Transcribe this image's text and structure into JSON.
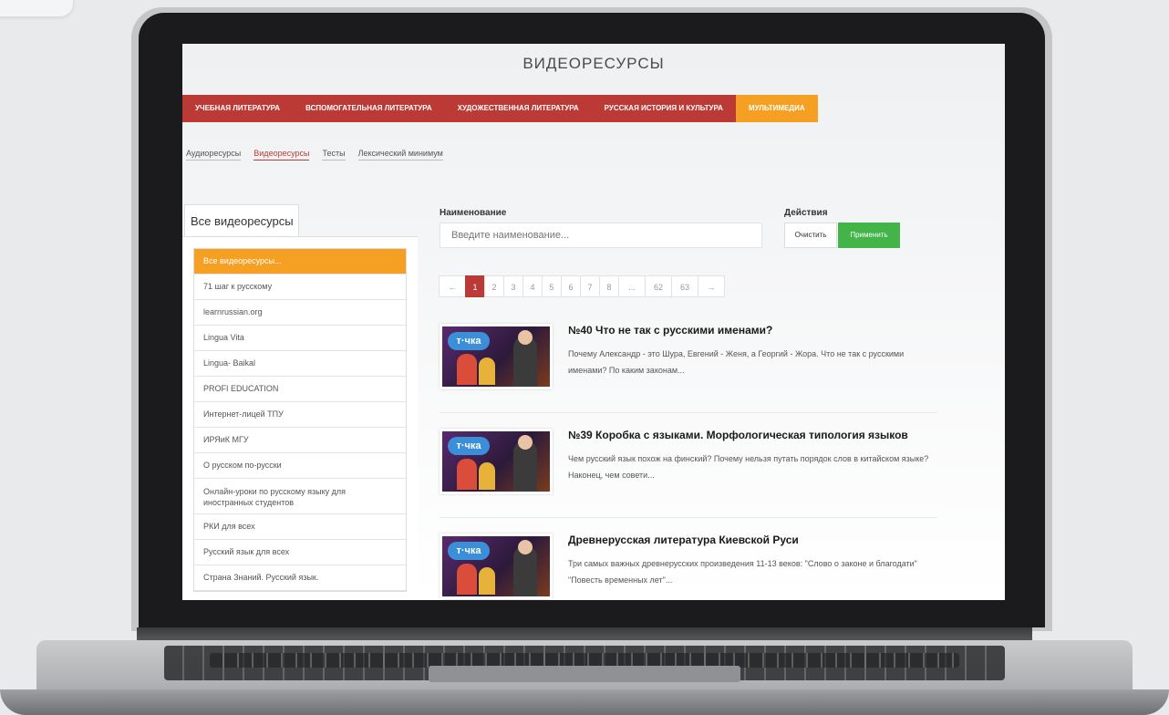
{
  "page": {
    "title": "ВИДЕОРЕСУРСЫ"
  },
  "main_nav": [
    {
      "label": "УЧЕБНАЯ ЛИТЕРАТУРА"
    },
    {
      "label": "ВСПОМОГАТЕЛЬНАЯ ЛИТЕРАТУРА"
    },
    {
      "label": "ХУДОЖЕСТВЕННАЯ ЛИТЕРАТУРА"
    },
    {
      "label": "РУССКАЯ ИСТОРИЯ И КУЛЬТУРА"
    },
    {
      "label": "МУЛЬТИМЕДИА",
      "active": true
    }
  ],
  "sub_nav": [
    {
      "label": "Аудиоресурсы"
    },
    {
      "label": "Видеоресурсы",
      "active": true
    },
    {
      "label": "Тесты"
    },
    {
      "label": "Лексический минимум"
    }
  ],
  "sidebar": {
    "tab_label": "Все видеоресурсы",
    "items": [
      {
        "label": "Все видеоресурсы...",
        "active": true
      },
      {
        "label": "71 шаг к русскому"
      },
      {
        "label": "learnrussian.org"
      },
      {
        "label": "Lingua Vita"
      },
      {
        "label": "Lingua- Baikal"
      },
      {
        "label": "PROFI EDUCATION"
      },
      {
        "label": "Интернет-лицей ТПУ"
      },
      {
        "label": "ИРЯиК МГУ"
      },
      {
        "label": "О русском по-русски"
      },
      {
        "label": "Онлайн-уроки по русскому языку для иностранных студентов"
      },
      {
        "label": "РКИ для всех"
      },
      {
        "label": "Русский язык для всех"
      },
      {
        "label": "Страна Знаний. Русский язык."
      }
    ]
  },
  "filter": {
    "name_label": "Наименование",
    "name_placeholder": "Введите наименование...",
    "actions_label": "Действия",
    "clear_label": "Очистить",
    "apply_label": "Применить"
  },
  "pagination": {
    "prev": "←",
    "pages": [
      "1",
      "2",
      "3",
      "4",
      "5",
      "6",
      "7",
      "8",
      "...",
      "62",
      "63"
    ],
    "current": "1",
    "next": "→"
  },
  "videos": [
    {
      "thumb_logo": "т·чка",
      "title": "№40 Что не так с русскими именами?",
      "description": "Почему Александр - это Шура, Евгений - Женя, а Георгий - Жора. Что не так с русскими именами? По каким законам..."
    },
    {
      "thumb_logo": "т·чка",
      "title": "№39 Коробка с языками. Морфологическая типология языков",
      "description": "Чем русский язык похож на финский? Почему нельзя путать порядок слов в китайском языке? Наконец, чем совети..."
    },
    {
      "thumb_logo": "т·чка",
      "title": "Древнерусская литература Киевской Руси",
      "description": "Три самых важных древнерусских произведения 11-13 веков: \"Слово о законе и благодати\" \"Повесть временных лет\"..."
    }
  ],
  "colors": {
    "nav_red": "#bb3a35",
    "accent_orange": "#f5a023",
    "apply_green": "#43b448"
  }
}
